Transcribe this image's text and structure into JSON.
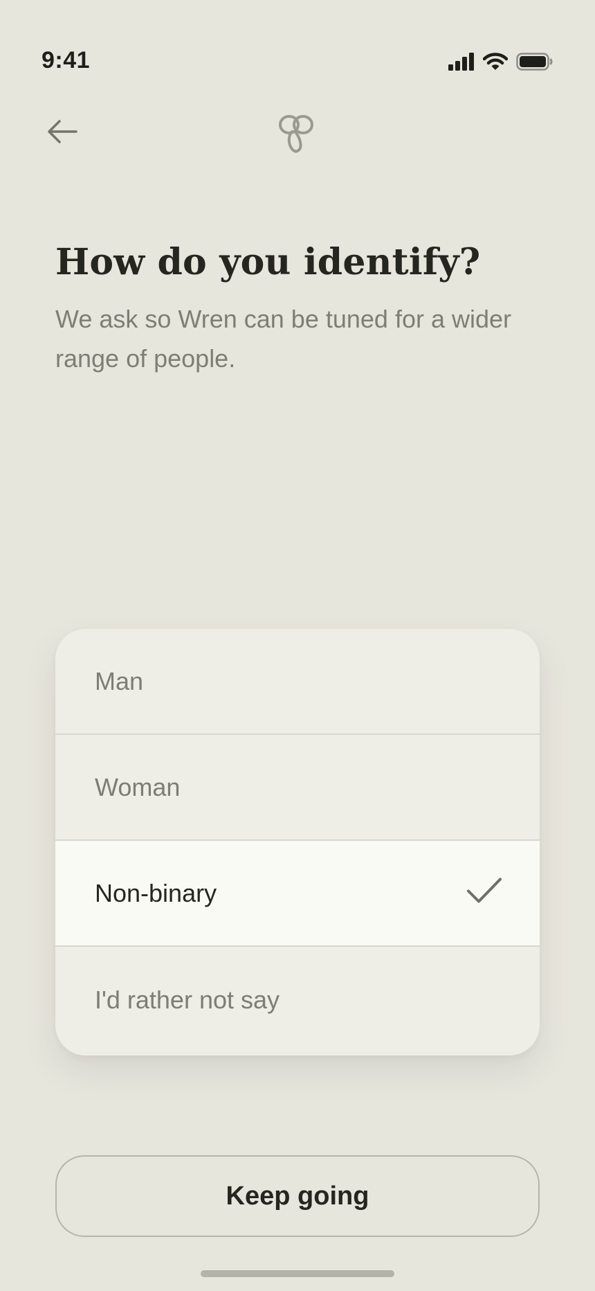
{
  "status_bar": {
    "time": "9:41",
    "icons": [
      "cellular-signal-icon",
      "wifi-icon",
      "battery-icon"
    ]
  },
  "nav": {
    "back_icon": "arrow-left-icon",
    "logo_icon": "wren-logo-icon"
  },
  "header": {
    "title": "How do you identify?",
    "subtitle": "We ask so Wren can be tuned for a wider range of people."
  },
  "options": [
    {
      "label": "Man",
      "selected": false
    },
    {
      "label": "Woman",
      "selected": false
    },
    {
      "label": "Non-binary",
      "selected": true
    },
    {
      "label": "I'd rather not say",
      "selected": false
    }
  ],
  "selected_indicator_icon": "checkmark-icon",
  "primary_button": {
    "label": "Keep going"
  },
  "colors": {
    "background": "#e7e6dd",
    "card": "#eeede6",
    "selected_row": "#fafaf4",
    "text_primary": "#24261f",
    "text_secondary": "#7c7d73"
  }
}
